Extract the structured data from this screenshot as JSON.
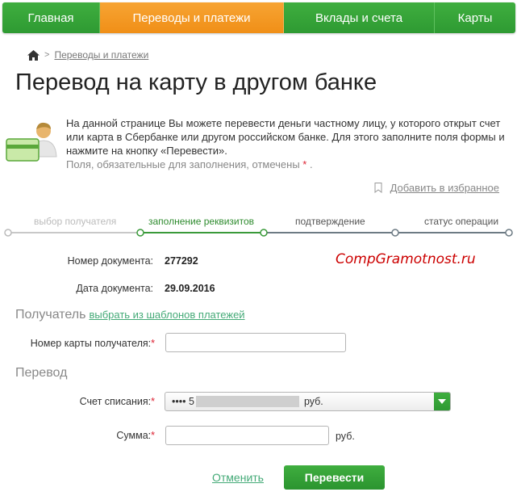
{
  "nav": {
    "items": [
      {
        "label": "Главная",
        "active": false
      },
      {
        "label": "Переводы и платежи",
        "active": true
      },
      {
        "label": "Вклады и счета",
        "active": false
      },
      {
        "label": "Карты",
        "active": false
      }
    ]
  },
  "breadcrumb": {
    "home_icon": "home-icon",
    "separator": ">",
    "link": "Переводы и платежи"
  },
  "page": {
    "title": "Перевод на карту в другом банке"
  },
  "info": {
    "text": "На данной странице Вы можете перевести деньги частному лицу, у которого открыт счет или карта в Сбербанке или другом российском банке. Для этого заполните поля формы и нажмите на кнопку «Перевести».",
    "required_note": "Поля, обязательные для заполнения, отмечены",
    "required_star": "*",
    "required_end": "."
  },
  "favorites": {
    "link": "Добавить в избранное"
  },
  "stepper": {
    "steps": [
      {
        "label": "выбор получателя",
        "state": "done"
      },
      {
        "label": "заполнение реквизитов",
        "state": "current"
      },
      {
        "label": "подтверждение",
        "state": "pending"
      },
      {
        "label": "статус операции",
        "state": "pending"
      }
    ]
  },
  "document": {
    "number_label": "Номер документа:",
    "number_value": "277292",
    "date_label": "Дата документа:",
    "date_value": "29.09.2016"
  },
  "watermark": "CompGramotnost.ru",
  "recipient": {
    "section_title": "Получатель",
    "template_link": "выбрать из шаблонов платежей",
    "card_label": "Номер карты получателя:",
    "card_star": "*",
    "card_value": ""
  },
  "transfer": {
    "section_title": "Перевод",
    "account_label": "Счет списания:",
    "account_star": "*",
    "account_prefix": "•••• 5",
    "account_suffix": "руб.",
    "amount_label": "Сумма:",
    "amount_star": "*",
    "amount_value": "",
    "amount_unit": "руб."
  },
  "actions": {
    "cancel": "Отменить",
    "submit": "Перевести"
  },
  "colors": {
    "brand_green": "#2e9a32",
    "active_orange": "#f08f17",
    "required_red": "#dd2233"
  }
}
